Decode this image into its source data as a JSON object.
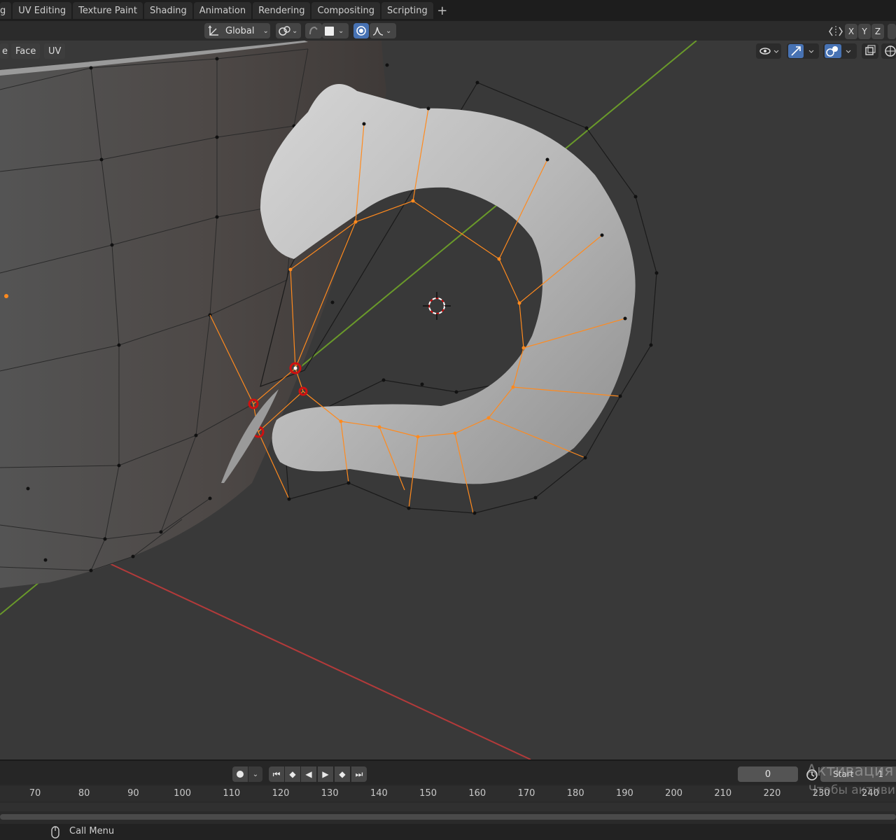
{
  "workspace_tabs": [
    "g",
    "UV Editing",
    "Texture Paint",
    "Shading",
    "Animation",
    "Rendering",
    "Compositing",
    "Scripting"
  ],
  "add_tab_symbol": "+",
  "header": {
    "orientation": "Global",
    "axes": {
      "x": "X",
      "y": "Y",
      "z": "Z"
    }
  },
  "edit_modes": {
    "e": "e",
    "face": "Face",
    "uv": "UV"
  },
  "timeline": {
    "current_frame": "0",
    "start_label": "Start",
    "start_value": "1",
    "ruler_ticks": [
      "70",
      "80",
      "90",
      "100",
      "110",
      "120",
      "130",
      "140",
      "150",
      "160",
      "170",
      "180",
      "190",
      "200",
      "210",
      "220",
      "230",
      "240"
    ]
  },
  "statusbar": {
    "call_menu": "Call Menu"
  },
  "watermark": {
    "line1": "Активация W",
    "line2": "Чтобы активир"
  },
  "icons": [
    "transform-orientation-icon",
    "snap-link-icon",
    "snap-icon",
    "proportional-edit-icon",
    "falloff-icon",
    "mirror-icon",
    "visibility-icon",
    "gizmo-icon",
    "overlay-icon",
    "xray-icon",
    "shading-icon",
    "mouse-icon",
    "record-icon",
    "jump-start-icon",
    "prev-keyframe-icon",
    "play-reverse-icon",
    "play-icon",
    "next-keyframe-icon",
    "jump-end-icon",
    "clock-icon"
  ],
  "colors": {
    "accent": "#4772b3",
    "selected": "#ff8a1e",
    "x_axis": "#b33a3a",
    "y_axis": "#6a9a2a",
    "viewport": "#393939"
  }
}
